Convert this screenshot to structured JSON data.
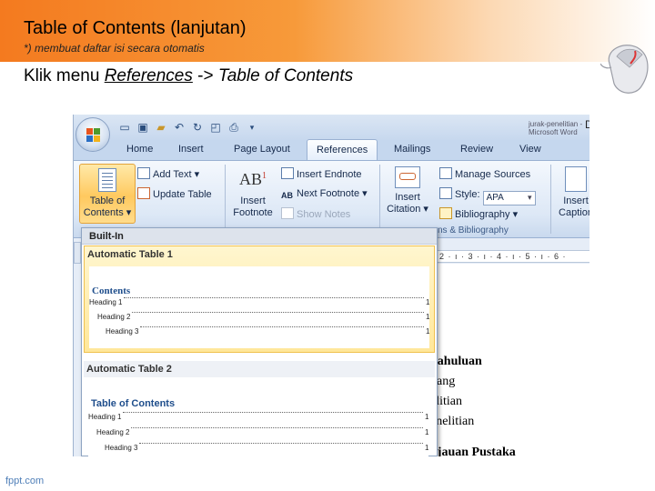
{
  "slide": {
    "title_main": "Table of Contents",
    "title_suffix": " (lanjutan)",
    "subtitle": "*) membuat daftar isi secara otomatis",
    "instruction_prefix": "Klik menu ",
    "instruction_menu": "References",
    "instruction_arrow": " -> ",
    "instruction_item": "Table of Contents",
    "watermark": "fppt.com"
  },
  "window": {
    "doc_title": "jurak-penelitian - Microsoft Word",
    "doc_title_tail": "D",
    "qat_icons": [
      "new-doc-icon",
      "save-icon",
      "open-icon",
      "undo-icon",
      "redo-icon",
      "print-preview-icon",
      "print-icon",
      "customize-icon"
    ]
  },
  "tabs": [
    "Home",
    "Insert",
    "Page Layout",
    "References",
    "Mailings",
    "Review",
    "View"
  ],
  "active_tab": "References",
  "ribbon": {
    "toc_label_line1": "Table of",
    "toc_label_line2": "Contents ▾",
    "add_text": "Add Text ▾",
    "update_table": "Update Table",
    "insert_footnote_line1": "Insert",
    "insert_footnote_line2": "Footnote",
    "footnote_glyph": "AB",
    "footnote_sup": "1",
    "insert_endnote": "Insert Endnote",
    "next_footnote": "Next Footnote ▾",
    "show_notes": "Show Notes",
    "insert_citation_line1": "Insert",
    "insert_citation_line2": "Citation ▾",
    "manage_sources": "Manage Sources",
    "style_label": "Style:",
    "style_value": "APA",
    "bibliography": "Bibliography ▾",
    "citations_group": "ns & Bibliography",
    "insert_caption_line1": "Insert",
    "insert_caption_line2": "Caption"
  },
  "ruler_text": "2 · ı · 3 · ı · 4 · ı · 5 · ı · 6 ·",
  "document_lines": [
    "dahuluan",
    "kang",
    "elitian",
    "enelitian",
    "njauan Pustaka"
  ],
  "dropdown": {
    "header": "Built-In",
    "items": [
      {
        "title": "Automatic Table 1",
        "heading": "Contents",
        "rows": [
          {
            "label": "Heading 1",
            "page": "1"
          },
          {
            "label": "Heading 2",
            "page": "1"
          },
          {
            "label": "Heading 3",
            "page": "1"
          }
        ]
      },
      {
        "title": "Automatic Table 2",
        "heading": "Table of Contents",
        "rows": [
          {
            "label": "Heading 1",
            "page": "1"
          },
          {
            "label": "Heading 2",
            "page": "1"
          },
          {
            "label": "Heading 3",
            "page": "1"
          }
        ]
      }
    ]
  },
  "colors": {
    "accent_orange": "#f47a1f",
    "ribbon_blue": "#c5d7ee",
    "selection_gold": "#ffe79a",
    "toc_heading_blue": "#1f4e8c"
  }
}
